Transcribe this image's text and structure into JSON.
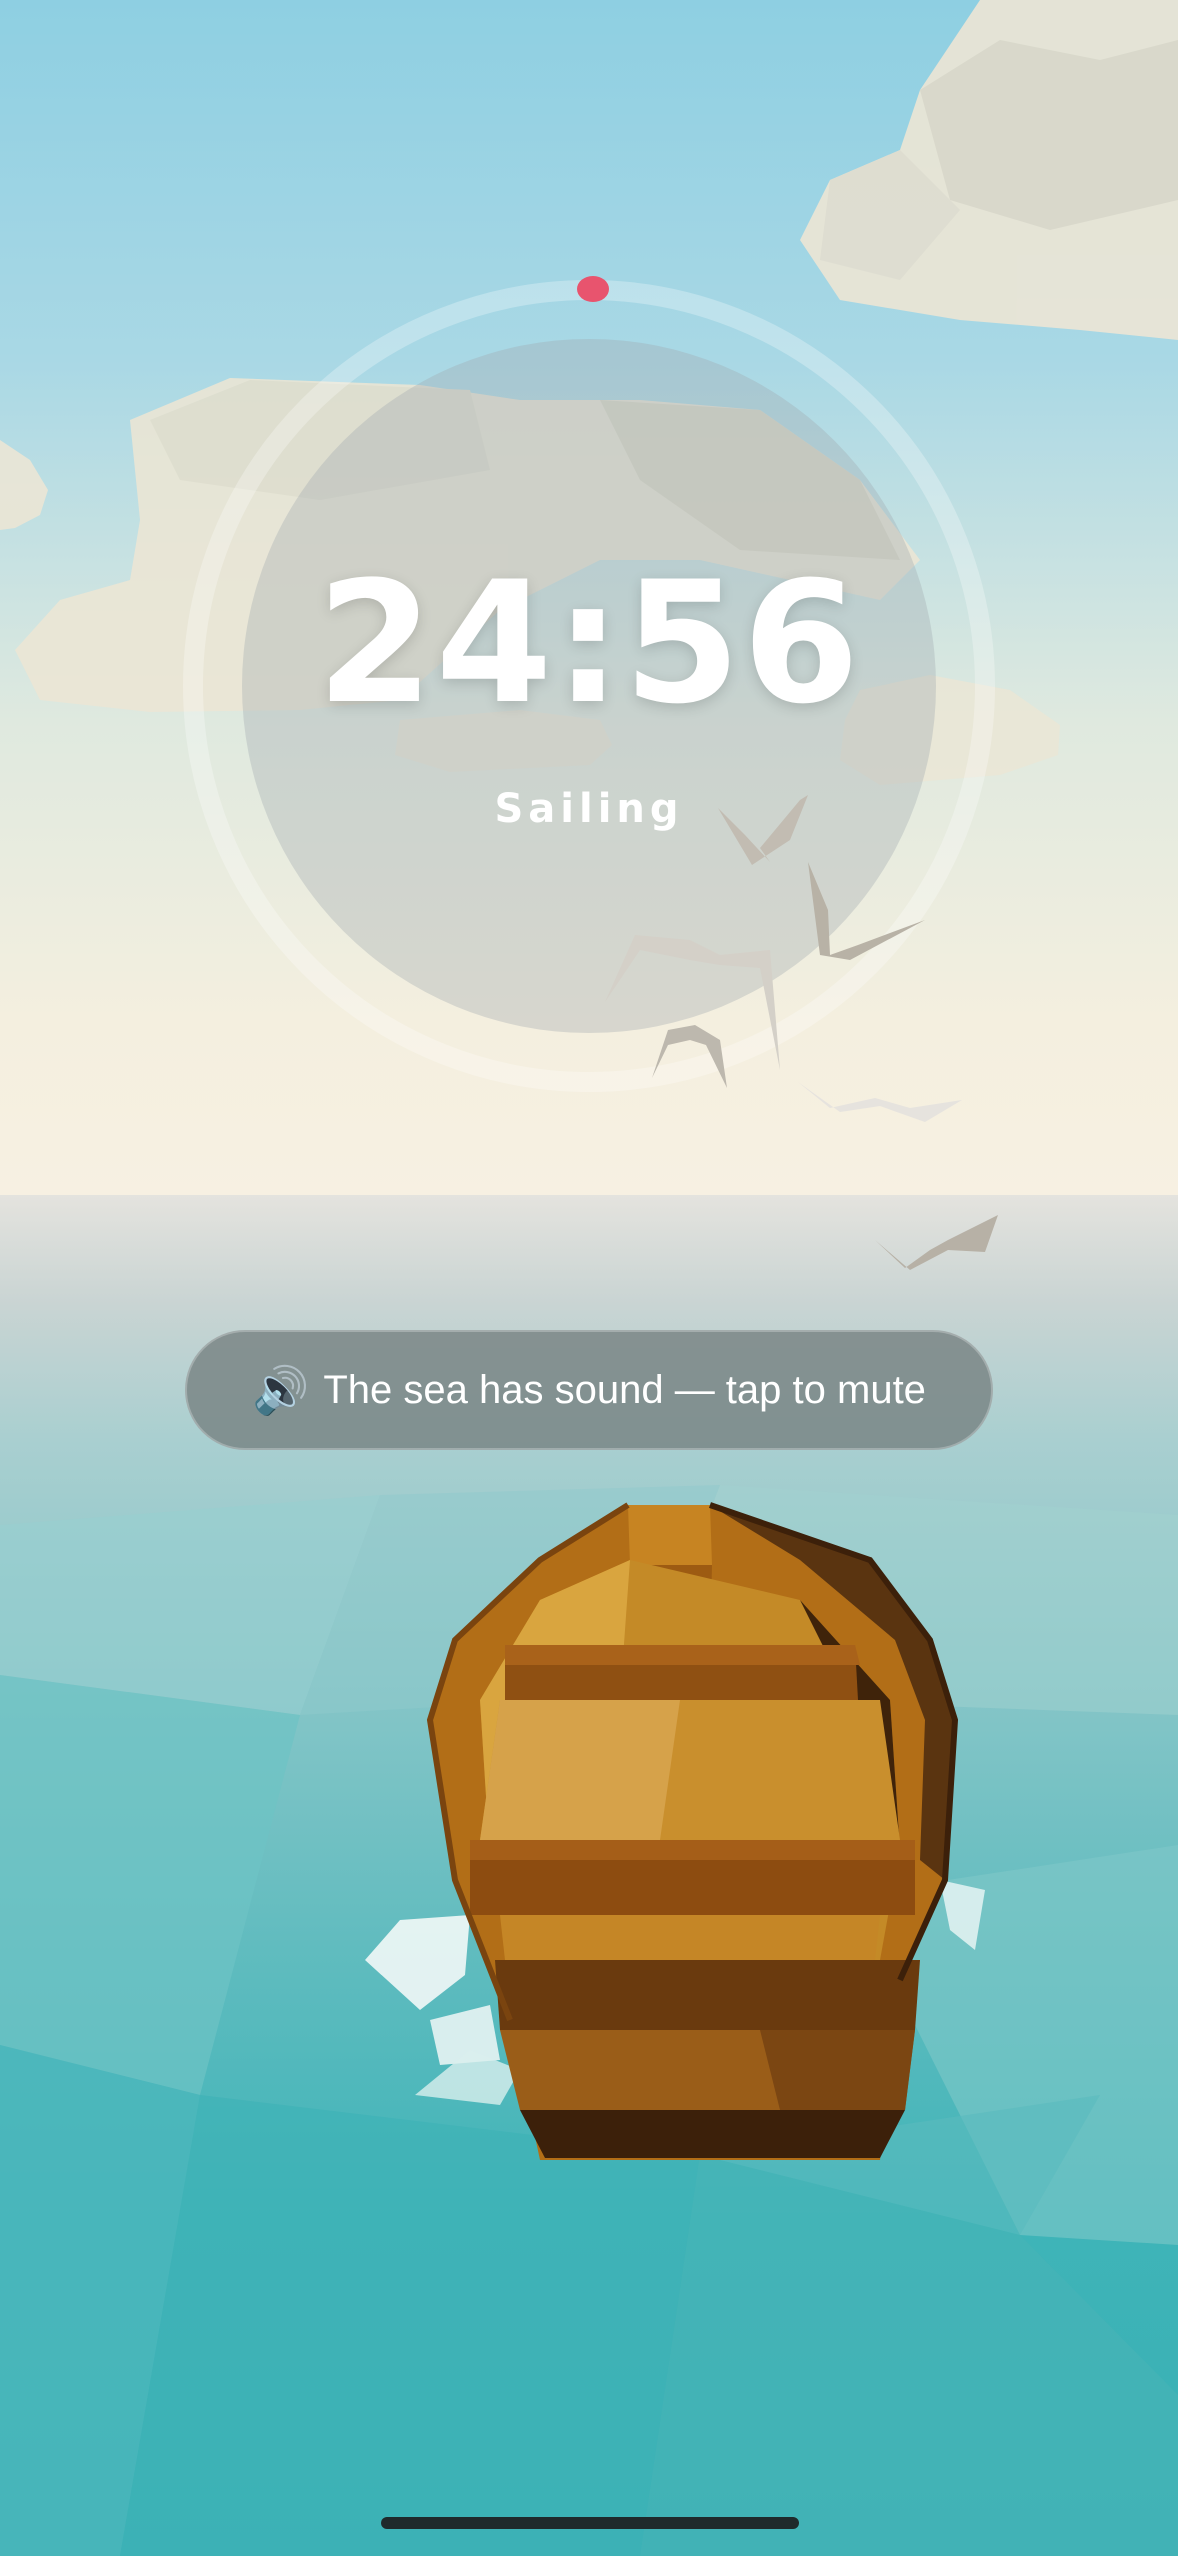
{
  "timer": {
    "time": "24:56",
    "status": "Sailing",
    "progress": 0.0
  },
  "toast": {
    "icon": "speaker-icon",
    "text": "The sea has sound — tap to mute"
  },
  "colors": {
    "progress_dot": "#e8546e",
    "sky_top": "#8ecfe2",
    "horizon": "#f7f0e2",
    "sea_deep": "#37b0b4",
    "boat_wood": "#b57a22"
  }
}
